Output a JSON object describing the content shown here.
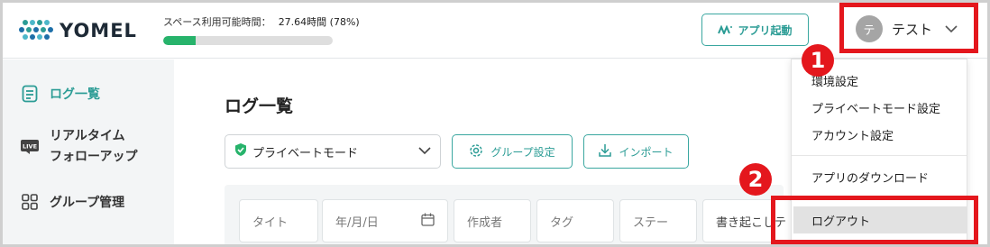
{
  "brand": {
    "name": "YOMEL"
  },
  "usage": {
    "label": "スペース利用可能時間：",
    "value": "27.64時間 (78%)",
    "percent": 19
  },
  "header": {
    "app_launch_label": "アプリ起動",
    "user_initial": "テ",
    "user_name": "テスト"
  },
  "sidebar": {
    "items": [
      {
        "label": "ログ一覧",
        "icon": "document-icon",
        "active": true
      },
      {
        "label_line1": "リアルタイム",
        "label_line2": "フォローアップ",
        "icon": "live-icon",
        "active": false
      },
      {
        "label": "グループ管理",
        "icon": "grid-icon",
        "active": false
      }
    ]
  },
  "main": {
    "title": "ログ一覧",
    "mode_select": "プライベートモード",
    "group_settings_label": "グループ設定",
    "import_label": "インポート",
    "filters": {
      "title_placeholder": "タイト",
      "date_placeholder": "年/月/日",
      "author_placeholder": "作成者",
      "tag_placeholder": "タグ",
      "status_placeholder": "ステー",
      "transcript_placeholder": "書き起こしテ"
    }
  },
  "dropdown": {
    "items": [
      {
        "label": "環境設定"
      },
      {
        "label": "プライベートモード設定"
      },
      {
        "label": "アカウント設定"
      },
      {
        "label": "アプリのダウンロード"
      },
      {
        "label": "ログアウト"
      }
    ]
  },
  "annotations": {
    "badge1": "1",
    "badge2": "2",
    "highlight_color": "#e4171d"
  },
  "colors": {
    "accent": "#2b9c95",
    "progress": "#27b36b"
  }
}
